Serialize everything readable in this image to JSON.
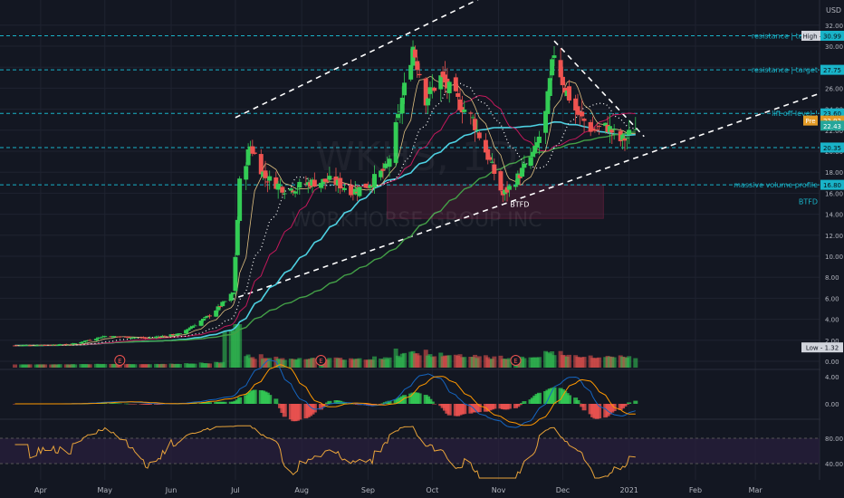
{
  "symbol_watermark": "WKHS, 1D",
  "company_watermark": "WORKHORSE GROUP INC",
  "currency": "USD",
  "colors": {
    "bg": "#131722",
    "grid": "#1f2330",
    "up": "#26a69a",
    "up_bright": "#33cc55",
    "down": "#ef5350",
    "level_line": "#19b3c8",
    "level_label_bg": "#19b3c8",
    "price_label_bg": "#26a69a",
    "pre_label_bg": "#e39b27",
    "sma_cyan": "#4dd0e1",
    "sma_green": "#43a047",
    "ema_pink": "#c2185b",
    "dotted_white": "#ffffff",
    "macd_line": "#1565c0",
    "signal_line": "#ff9800",
    "rsi_line": "#e8a33a",
    "rsi_band": "#2a1f3d",
    "volume_box": "#6d1f3e"
  },
  "price_axis": {
    "ticks": [
      "32.00",
      "30.00",
      "28.00",
      "26.00",
      "24.00",
      "22.00",
      "20.00",
      "18.00",
      "16.00",
      "14.00",
      "12.00",
      "10.00",
      "8.00",
      "6.00",
      "4.00",
      "2.00",
      "0.00"
    ]
  },
  "level_labels": [
    {
      "text": "High - 30.99",
      "value": 30.99,
      "kind": "high"
    },
    {
      "text": "30.99",
      "value": 30.99,
      "kind": "level"
    },
    {
      "text": "27.75",
      "value": 27.75,
      "kind": "level"
    },
    {
      "text": "23.60",
      "value": 23.6,
      "kind": "level"
    },
    {
      "text": "22.92",
      "value": 22.92,
      "kind": "pre"
    },
    {
      "text": "22.43",
      "value": 22.43,
      "kind": "price"
    },
    {
      "text": "20.35",
      "value": 20.35,
      "kind": "level"
    },
    {
      "text": "16.80",
      "value": 16.8,
      "kind": "level"
    },
    {
      "text": "Low - 1.32",
      "value": 1.32,
      "kind": "low"
    }
  ],
  "pre_tag": "Pre",
  "annotations": [
    {
      "text": "resistance | target",
      "value": 30.99
    },
    {
      "text": "resistance | target",
      "value": 27.75
    },
    {
      "text": "lift off level-!",
      "value": 23.6
    },
    {
      "text": "massive volume profile",
      "value": 16.8
    },
    {
      "text": "BTFD",
      "value": 15.2
    }
  ],
  "earnings_marker": "E",
  "macd_axis": [
    "4.00",
    "0.00"
  ],
  "rsi_axis": [
    "80.00",
    "40.00"
  ],
  "time_axis": [
    "Apr",
    "May",
    "Jun",
    "Jul",
    "Aug",
    "Sep",
    "Oct",
    "Nov",
    "Dec",
    "2021",
    "Feb",
    "Mar"
  ],
  "chart_data": {
    "type": "candlestick",
    "title": "WKHS, 1D",
    "subtitle": "WORKHORSE GROUP INC",
    "ylabel": "USD",
    "ylim": [
      0,
      32
    ],
    "x_range": [
      "Apr 2020",
      "Mar 2021"
    ],
    "levels": [
      30.99,
      27.75,
      23.6,
      20.35,
      16.8
    ],
    "last_price": 22.43,
    "premarket_price": 22.92,
    "high": 30.99,
    "low": 1.32,
    "close_path": [
      {
        "x": "2020-03-20",
        "y": 1.5
      },
      {
        "x": "2020-04-15",
        "y": 1.6
      },
      {
        "x": "2020-05-01",
        "y": 2.4
      },
      {
        "x": "2020-05-20",
        "y": 2.2
      },
      {
        "x": "2020-06-05",
        "y": 2.6
      },
      {
        "x": "2020-06-20",
        "y": 4.5
      },
      {
        "x": "2020-06-30",
        "y": 6.5
      },
      {
        "x": "2020-07-03",
        "y": 17.0
      },
      {
        "x": "2020-07-08",
        "y": 20.5
      },
      {
        "x": "2020-07-15",
        "y": 17.5
      },
      {
        "x": "2020-07-25",
        "y": 16.3
      },
      {
        "x": "2020-08-05",
        "y": 17.0
      },
      {
        "x": "2020-08-15",
        "y": 17.2
      },
      {
        "x": "2020-08-25",
        "y": 16.2
      },
      {
        "x": "2020-09-01",
        "y": 16.8
      },
      {
        "x": "2020-09-10",
        "y": 18.5
      },
      {
        "x": "2020-09-16",
        "y": 24.0
      },
      {
        "x": "2020-09-22",
        "y": 30.0
      },
      {
        "x": "2020-09-28",
        "y": 25.0
      },
      {
        "x": "2020-10-05",
        "y": 27.0
      },
      {
        "x": "2020-10-12",
        "y": 25.0
      },
      {
        "x": "2020-10-20",
        "y": 23.0
      },
      {
        "x": "2020-10-28",
        "y": 19.0
      },
      {
        "x": "2020-11-03",
        "y": 15.8
      },
      {
        "x": "2020-11-10",
        "y": 17.5
      },
      {
        "x": "2020-11-18",
        "y": 20.0
      },
      {
        "x": "2020-11-23",
        "y": 23.5
      },
      {
        "x": "2020-11-27",
        "y": 29.5
      },
      {
        "x": "2020-12-02",
        "y": 26.0
      },
      {
        "x": "2020-12-08",
        "y": 23.5
      },
      {
        "x": "2020-12-15",
        "y": 22.0
      },
      {
        "x": "2020-12-22",
        "y": 22.3
      },
      {
        "x": "2020-12-28",
        "y": 21.0
      },
      {
        "x": "2020-12-31",
        "y": 21.3
      },
      {
        "x": "2021-01-04",
        "y": 22.43
      }
    ],
    "volume_profile_box": {
      "from": "2020-09-10",
      "to": "2020-12-20",
      "y_low": 13.6,
      "y_high": 16.8
    }
  }
}
